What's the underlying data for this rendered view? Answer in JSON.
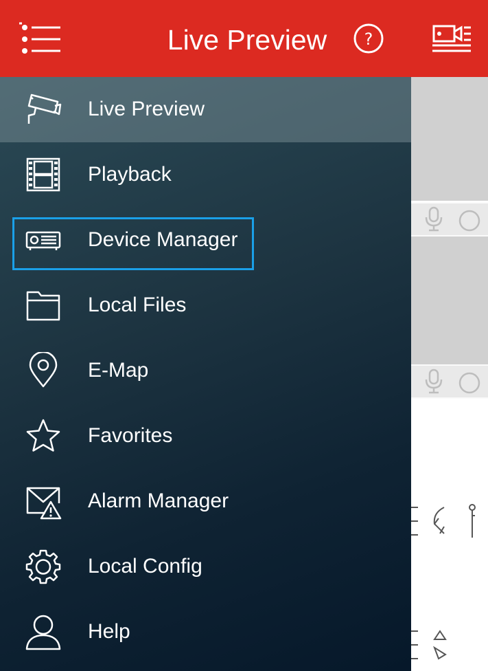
{
  "header": {
    "title": "Live Preview",
    "bg_color": "#dc2a21",
    "menu_icon": "hamburger-menu-icon",
    "help_icon": "help-circle-icon",
    "record_icon": "record-list-icon"
  },
  "drawer": {
    "items": [
      {
        "label": "Live Preview",
        "icon": "cctv-camera-icon",
        "active": true
      },
      {
        "label": "Playback",
        "icon": "film-strip-icon"
      },
      {
        "label": "Device Manager",
        "icon": "dvr-device-icon",
        "highlighted": true
      },
      {
        "label": "Local Files",
        "icon": "folder-icon"
      },
      {
        "label": "E-Map",
        "icon": "map-pin-icon"
      },
      {
        "label": "Favorites",
        "icon": "star-icon"
      },
      {
        "label": "Alarm Manager",
        "icon": "alarm-mail-icon"
      },
      {
        "label": "Local Config",
        "icon": "gear-icon"
      },
      {
        "label": "Help",
        "icon": "user-icon"
      }
    ],
    "highlight_color": "#1aa0e8"
  }
}
